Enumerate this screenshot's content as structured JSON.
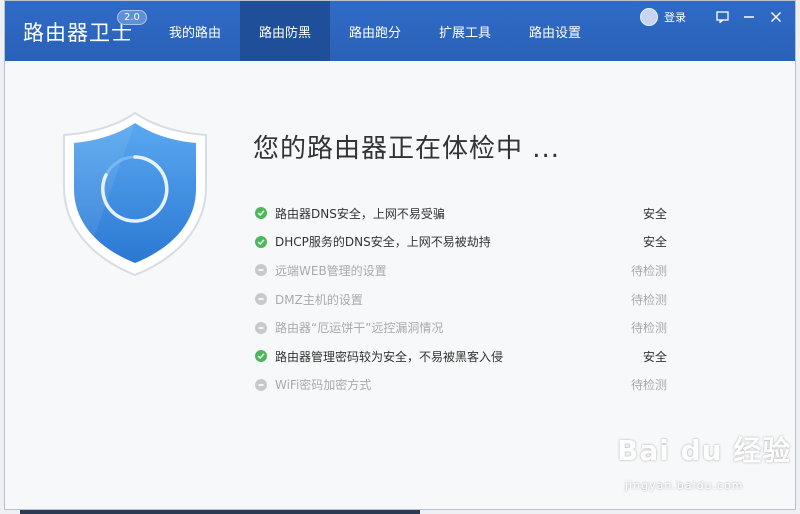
{
  "app": {
    "title": "路由器卫士",
    "version": "2.0"
  },
  "nav": {
    "tabs": [
      {
        "label": "我的路由",
        "active": false
      },
      {
        "label": "路由防黑",
        "active": true
      },
      {
        "label": "路由跑分",
        "active": false
      },
      {
        "label": "扩展工具",
        "active": false
      },
      {
        "label": "路由设置",
        "active": false
      }
    ]
  },
  "topbar": {
    "login_label": "登录"
  },
  "main": {
    "heading": "您的路由器正在体检中 ...",
    "checks": [
      {
        "label": "路由器DNS安全，上网不易受骗",
        "status": "安全",
        "state": "ok"
      },
      {
        "label": "DHCP服务的DNS安全，上网不易被劫持",
        "status": "安全",
        "state": "ok"
      },
      {
        "label": "远端WEB管理的设置",
        "status": "待检测",
        "state": "pending"
      },
      {
        "label": "DMZ主机的设置",
        "status": "待检测",
        "state": "pending"
      },
      {
        "label": "路由器“厄运饼干”远控漏洞情况",
        "status": "待检测",
        "state": "pending"
      },
      {
        "label": "路由器管理密码较为安全，不易被黑客入侵",
        "status": "安全",
        "state": "ok"
      },
      {
        "label": "WiFi密码加密方式",
        "status": "待检测",
        "state": "pending"
      }
    ]
  },
  "watermark": {
    "brand": "Bai du 经验",
    "url": "jingyan.baidu.com"
  },
  "colors": {
    "header": "#2a61b8",
    "active_tab": "#1f4f99",
    "ok": "#4cb85a",
    "pending": "#c7c9cc",
    "shield": "#3b8de0"
  }
}
